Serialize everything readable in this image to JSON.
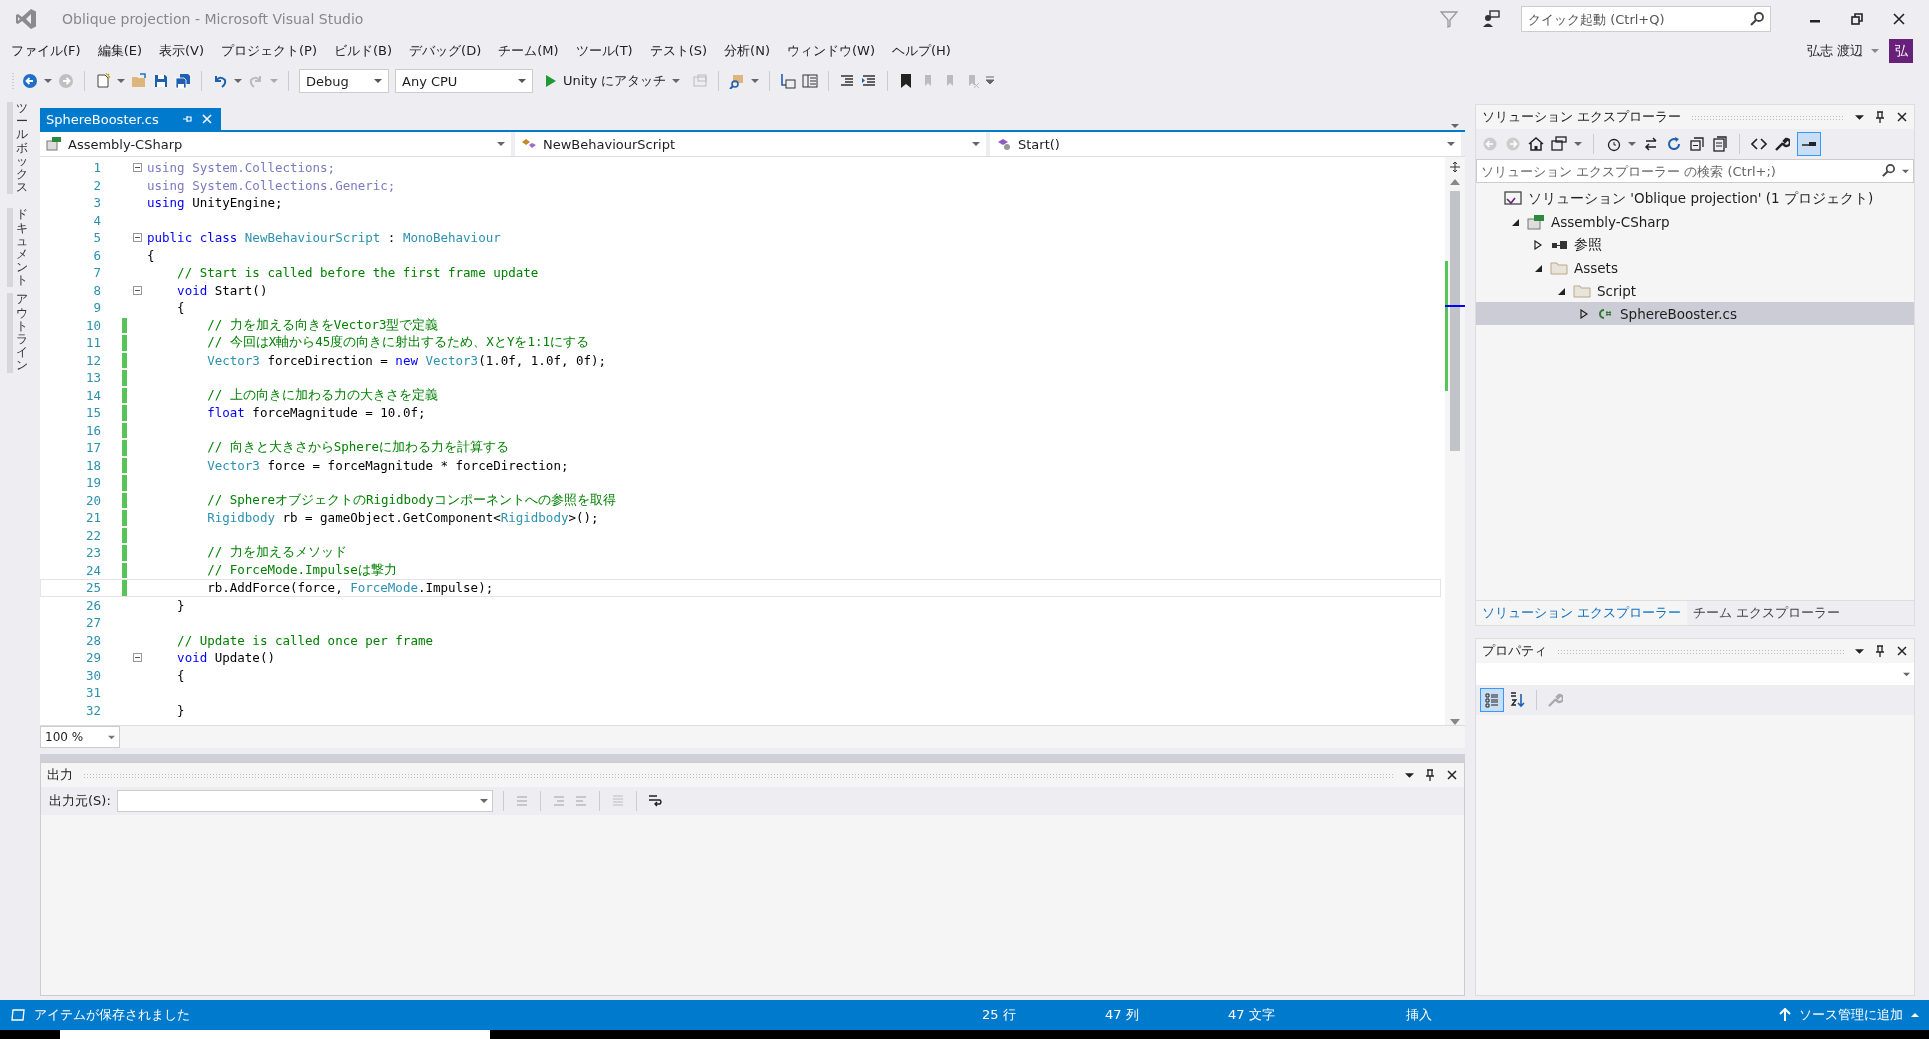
{
  "title_bar": {
    "title": "Oblique projection - Microsoft Visual Studio",
    "quick_launch": {
      "placeholder": "クイック起動 (Ctrl+Q)"
    },
    "user_name": "弘志 渡辺",
    "user_initial": "弘"
  },
  "menu": [
    "ファイル(F)",
    "編集(E)",
    "表示(V)",
    "プロジェクト(P)",
    "ビルド(B)",
    "デバッグ(D)",
    "チーム(M)",
    "ツール(T)",
    "テスト(S)",
    "分析(N)",
    "ウィンドウ(W)",
    "ヘルプ(H)"
  ],
  "toolbar": {
    "configuration": "Debug",
    "platform": "Any CPU",
    "run_label": "Unity にアタッチ"
  },
  "side_tabs": [
    {
      "words": [
        "ツールボックス"
      ]
    },
    {
      "words": [
        "ドキュメント",
        "アウトライン"
      ]
    }
  ],
  "document_tabs": [
    {
      "label": "SphereBooster.cs",
      "selected": true
    }
  ],
  "nav_bar": {
    "project": "Assembly-CSharp",
    "class": "NewBehaviourScript",
    "member": "Start()"
  },
  "editor": {
    "zoom": "100 %",
    "lines": [
      {
        "number": "1",
        "fold": true,
        "changed": false,
        "current": false,
        "segments": [
          {
            "text": "using System.Collections;",
            "kind": "faded"
          }
        ]
      },
      {
        "number": "2",
        "fold": false,
        "changed": false,
        "current": false,
        "segments": [
          {
            "text": "using System.Collections.Generic;",
            "kind": "faded"
          }
        ]
      },
      {
        "number": "3",
        "fold": false,
        "changed": false,
        "current": false,
        "segments": [
          {
            "text": "using",
            "kind": "keyword"
          },
          {
            "text": " UnityEngine;",
            "kind": "plain"
          }
        ]
      },
      {
        "number": "4",
        "fold": false,
        "changed": false,
        "current": false
      },
      {
        "number": "5",
        "fold": true,
        "changed": false,
        "current": false,
        "segments": [
          {
            "text": "public class ",
            "kind": "keyword"
          },
          {
            "text": "NewBehaviourScript",
            "kind": "type"
          },
          {
            "text": " : ",
            "kind": "plain"
          },
          {
            "text": "MonoBehaviour",
            "kind": "type"
          }
        ]
      },
      {
        "number": "6",
        "fold": false,
        "changed": false,
        "current": false,
        "segments": [
          {
            "text": "{",
            "kind": "plain"
          }
        ]
      },
      {
        "number": "7",
        "fold": false,
        "changed": false,
        "current": false,
        "segments": [
          {
            "text": "    // Start is called before the first frame update",
            "kind": "comment"
          }
        ]
      },
      {
        "number": "8",
        "fold": true,
        "changed": false,
        "current": false,
        "segments": [
          {
            "text": "    void ",
            "kind": "keyword"
          },
          {
            "text": "Start()",
            "kind": "plain"
          }
        ]
      },
      {
        "number": "9",
        "fold": false,
        "changed": false,
        "current": false,
        "segments": [
          {
            "text": "    {",
            "kind": "plain"
          }
        ]
      },
      {
        "number": "10",
        "fold": false,
        "changed": true,
        "current": false,
        "segments": [
          {
            "text": "        // 力を加える向きをVector3型で定義",
            "kind": "comment"
          }
        ]
      },
      {
        "number": "11",
        "fold": false,
        "changed": true,
        "current": false,
        "segments": [
          {
            "text": "        // 今回はX軸から45度の向きに射出するため、XとYを1:1にする",
            "kind": "comment"
          }
        ]
      },
      {
        "number": "12",
        "fold": false,
        "changed": true,
        "current": false,
        "segments": [
          {
            "text": "        Vector3",
            "kind": "type"
          },
          {
            "text": " forceDirection = ",
            "kind": "plain"
          },
          {
            "text": "new",
            "kind": "keyword"
          },
          {
            "text": " Vector3",
            "kind": "type"
          },
          {
            "text": "(1.0f, 1.0f, 0f);",
            "kind": "plain"
          }
        ]
      },
      {
        "number": "13",
        "fold": false,
        "changed": true,
        "current": false
      },
      {
        "number": "14",
        "fold": false,
        "changed": true,
        "current": false,
        "segments": [
          {
            "text": "        // 上の向きに加わる力の大きさを定義",
            "kind": "comment"
          }
        ]
      },
      {
        "number": "15",
        "fold": false,
        "changed": true,
        "current": false,
        "segments": [
          {
            "text": "        float",
            "kind": "keyword"
          },
          {
            "text": " forceMagnitude = 10.0f;",
            "kind": "plain"
          }
        ]
      },
      {
        "number": "16",
        "fold": false,
        "changed": true,
        "current": false
      },
      {
        "number": "17",
        "fold": false,
        "changed": true,
        "current": false,
        "segments": [
          {
            "text": "        // 向きと大きさからSphereに加わる力を計算する",
            "kind": "comment"
          }
        ]
      },
      {
        "number": "18",
        "fold": false,
        "changed": true,
        "current": false,
        "segments": [
          {
            "text": "        Vector3",
            "kind": "type"
          },
          {
            "text": " force = forceMagnitude * forceDirection;",
            "kind": "plain"
          }
        ]
      },
      {
        "number": "19",
        "fold": false,
        "changed": true,
        "current": false
      },
      {
        "number": "20",
        "fold": false,
        "changed": true,
        "current": false,
        "segments": [
          {
            "text": "        // SphereオブジェクトのRigidbodyコンポーネントへの参照を取得",
            "kind": "comment"
          }
        ]
      },
      {
        "number": "21",
        "fold": false,
        "changed": true,
        "current": false,
        "segments": [
          {
            "text": "        Rigidbody",
            "kind": "type"
          },
          {
            "text": " rb = gameObject.GetComponent<",
            "kind": "plain"
          },
          {
            "text": "Rigidbody",
            "kind": "type"
          },
          {
            "text": ">();",
            "kind": "plain"
          }
        ]
      },
      {
        "number": "22",
        "fold": false,
        "changed": true,
        "current": false
      },
      {
        "number": "23",
        "fold": false,
        "changed": true,
        "current": false,
        "segments": [
          {
            "text": "        // 力を加えるメソッド",
            "kind": "comment"
          }
        ]
      },
      {
        "number": "24",
        "fold": false,
        "changed": true,
        "current": false,
        "segments": [
          {
            "text": "        // ForceMode.Impulseは撃力",
            "kind": "comment"
          }
        ]
      },
      {
        "number": "25",
        "fold": false,
        "changed": true,
        "current": true,
        "segments": [
          {
            "text": "        rb.AddForce(force, ",
            "kind": "plain"
          },
          {
            "text": "ForceMode",
            "kind": "type"
          },
          {
            "text": ".Impulse);",
            "kind": "plain"
          }
        ]
      },
      {
        "number": "26",
        "fold": false,
        "changed": false,
        "current": false,
        "segments": [
          {
            "text": "    }",
            "kind": "plain"
          }
        ]
      },
      {
        "number": "27",
        "fold": false,
        "changed": false,
        "current": false
      },
      {
        "number": "28",
        "fold": false,
        "changed": false,
        "current": false,
        "segments": [
          {
            "text": "    // Update is called once per frame",
            "kind": "comment"
          }
        ]
      },
      {
        "number": "29",
        "fold": true,
        "changed": false,
        "current": false,
        "segments": [
          {
            "text": "    void ",
            "kind": "keyword"
          },
          {
            "text": "Update()",
            "kind": "plain"
          }
        ]
      },
      {
        "number": "30",
        "fold": false,
        "changed": false,
        "current": false,
        "segments": [
          {
            "text": "    {",
            "kind": "plain"
          }
        ]
      },
      {
        "number": "31",
        "fold": false,
        "changed": false,
        "current": false
      },
      {
        "number": "32",
        "fold": false,
        "changed": false,
        "current": false,
        "segments": [
          {
            "text": "    }",
            "kind": "plain"
          }
        ]
      }
    ]
  },
  "output": {
    "title": "出力",
    "source_label": "出力元(S):"
  },
  "solution_explorer": {
    "title": "ソリューション エクスプローラー",
    "search": {
      "placeholder": "ソリューション エクスプローラー の検索 (Ctrl+;)"
    },
    "tree": [
      {
        "label": "ソリューション 'Oblique projection' (1 プロジェクト)",
        "kind": "solution",
        "selected": false,
        "children": [
          {
            "label": "Assembly-CSharp",
            "kind": "project",
            "selected": false,
            "expanded": true,
            "children": [
              {
                "label": "参照",
                "kind": "references",
                "selected": false,
                "expanded": false
              },
              {
                "label": "Assets",
                "kind": "folder",
                "selected": false,
                "expanded": true,
                "children": [
                  {
                    "label": "Script",
                    "kind": "folder",
                    "selected": false,
                    "expanded": true,
                    "children": [
                      {
                        "label": "SphereBooster.cs",
                        "kind": "csfile",
                        "selected": true,
                        "expanded": false
                      }
                    ]
                  }
                ]
              }
            ]
          }
        ]
      }
    ],
    "tabs": [
      {
        "label": "ソリューション エクスプローラー",
        "selected": true
      },
      {
        "label": "チーム エクスプローラー",
        "selected": false
      }
    ]
  },
  "properties": {
    "title": "プロパティ"
  },
  "status_bar": {
    "message": "アイテムが保存されました",
    "line": "25 行",
    "column": "47 列",
    "character": "47 文字",
    "mode": "挿入",
    "source_control": "ソース管理に追加"
  }
}
